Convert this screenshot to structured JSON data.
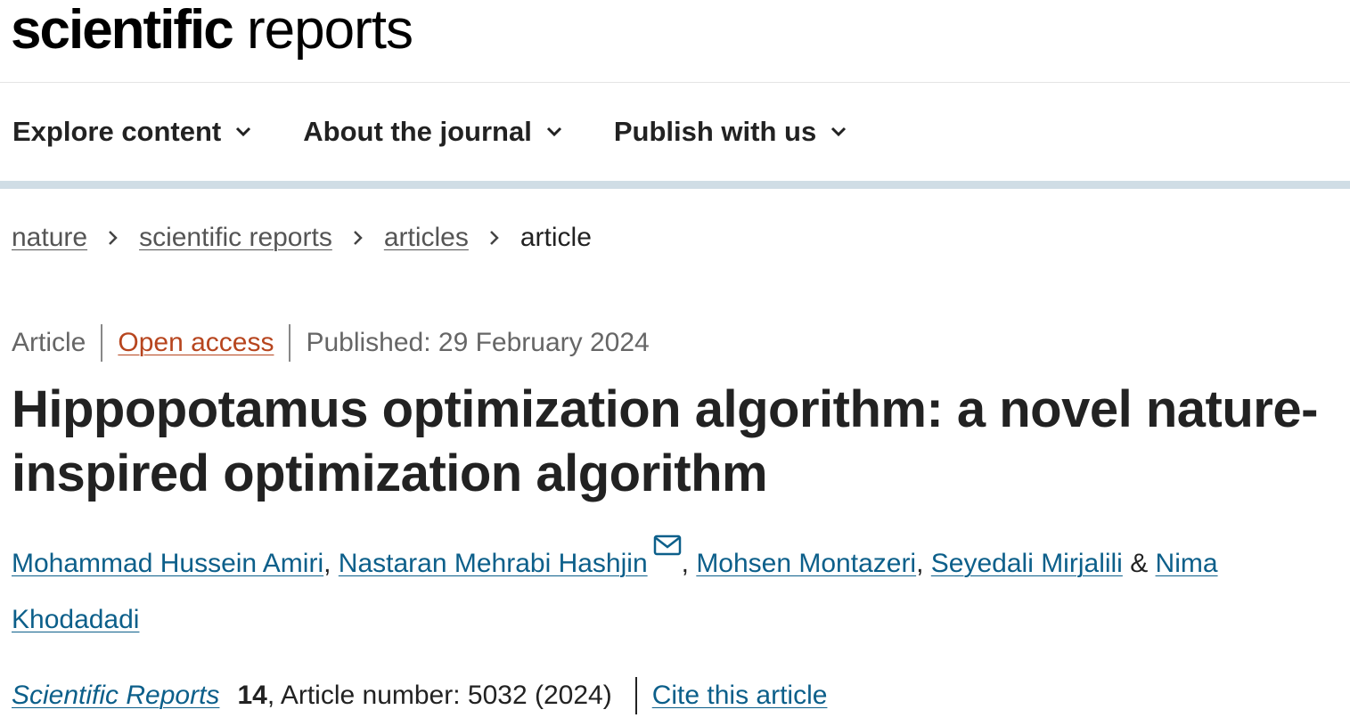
{
  "header": {
    "logo_bold": "scientific",
    "logo_light": "reports"
  },
  "nav": {
    "items": [
      {
        "label": "Explore content",
        "icon": "chevron-down-icon"
      },
      {
        "label": "About the journal",
        "icon": "chevron-down-icon"
      },
      {
        "label": "Publish with us",
        "icon": "chevron-down-icon"
      }
    ]
  },
  "breadcrumb": {
    "items": [
      "nature",
      "scientific reports",
      "articles"
    ],
    "current": "article",
    "separator_icon": "chevron-right-icon"
  },
  "article": {
    "type": "Article",
    "access": "Open access",
    "published": "Published: 29 February 2024",
    "title": "Hippopotamus optimization algorithm: a novel nature-inspired optimization algorithm",
    "authors": [
      "Mohammad Hussein Amiri",
      "Nastaran Mehrabi Hashjin",
      "Mohsen Montazeri",
      "Seyedali Mirjalili",
      "Nima Khodadadi"
    ],
    "author_separators": [
      ", ",
      ", ",
      ", ",
      " & "
    ],
    "corresponding_icon": "mail-icon",
    "journal": "Scientific Reports",
    "volume": "14",
    "article_number_text": ", Article number: 5032 (2024)",
    "cite_label": "Cite this article"
  },
  "colors": {
    "link": "#0c5f8a",
    "open_access": "#b7451e",
    "nav_border": "#d0dde5",
    "text": "#222222",
    "muted": "#666666"
  }
}
